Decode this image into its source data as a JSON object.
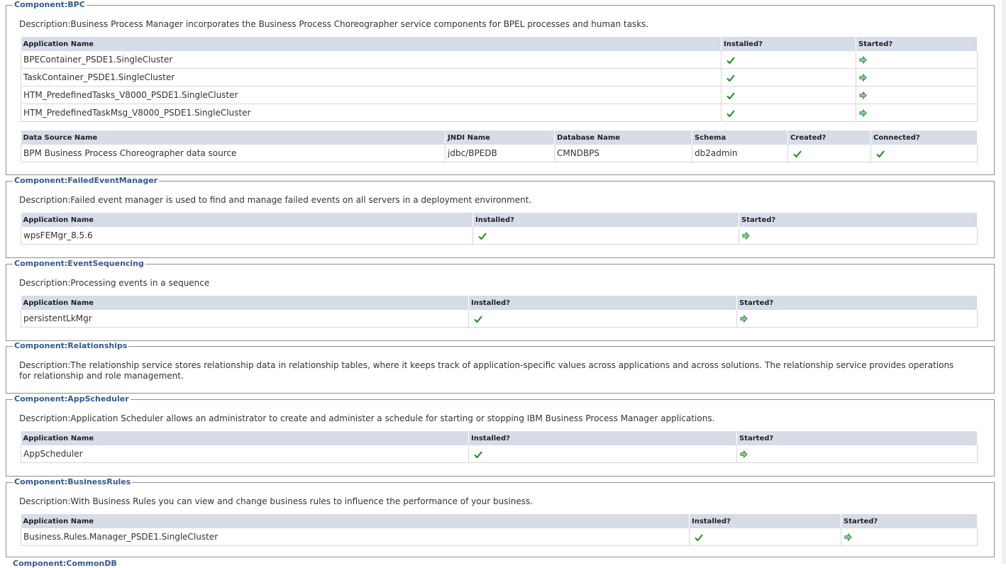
{
  "labels": {
    "app_name": "Application Name",
    "installed": "Installed?",
    "started": "Started?",
    "ds_name": "Data Source Name",
    "jndi": "JNDI Name",
    "db_name": "Database Name",
    "schema": "Schema",
    "created": "Created?",
    "connected": "Connected?"
  },
  "colors": {
    "check": "#1e8a1e",
    "arrow": "#2f7d3a",
    "legend": "#33598c",
    "header_bg": "#d6dde8"
  },
  "bpc": {
    "legend": "Component:BPC",
    "description": "Description:Business Process Manager incorporates the Business Process Choreographer service components for BPEL processes and human tasks.",
    "apps": [
      "BPEContainer_PSDE1.SingleCluster",
      "TaskContainer_PSDE1.SingleCluster",
      "HTM_PredefinedTasks_V8000_PSDE1.SingleCluster",
      "HTM_PredefinedTaskMsg_V8000_PSDE1.SingleCluster"
    ],
    "datasource": {
      "name": "BPM Business Process Choreographer data source",
      "jndi": "jdbc/BPEDB",
      "database": "CMNDBPS",
      "schema": "db2admin"
    }
  },
  "fem": {
    "legend": "Component:FailedEventManager",
    "description": "Description:Failed event manager is used to find and manage failed events on all servers in a deployment environment.",
    "app": "wpsFEMgr_8.5.6"
  },
  "seq": {
    "legend": "Component:EventSequencing",
    "description": "Description:Processing events in a sequence",
    "app": "persistentLkMgr"
  },
  "rel": {
    "legend": "Component:Relationships",
    "description": "Description:The relationship service stores relationship data in relationship tables, where it keeps track of application-specific values across applications and across solutions. The relationship service provides operations for relationship and role management."
  },
  "sched": {
    "legend": "Component:AppScheduler",
    "description": "Description:Application Scheduler allows an administrator to create and administer a schedule for starting or stopping IBM Business Process Manager applications.",
    "app": "AppScheduler"
  },
  "rules": {
    "legend": "Component:BusinessRules",
    "description": "Description:With Business Rules you can view and change business rules to influence the performance of your business.",
    "app": "Business.Rules.Manager_PSDE1.SingleCluster"
  },
  "next": {
    "legend": "Component:CommonDB"
  }
}
